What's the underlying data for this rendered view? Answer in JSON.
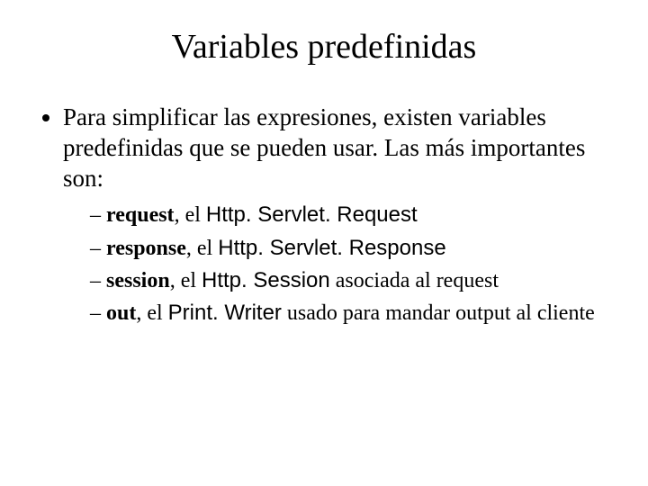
{
  "title": "Variables predefinidas",
  "intro": "Para simplificar las expresiones, existen variables predefinidas que se pueden usar. Las más importantes son:",
  "items": {
    "i0": {
      "name": " request",
      "mid": ", el ",
      "code": "Http. Servlet. Request",
      "tail": ""
    },
    "i1": {
      "name": "response",
      "mid": ", el ",
      "code": "Http. Servlet. Response",
      "tail": ""
    },
    "i2": {
      "name": "session",
      "mid": ", el ",
      "code": "Http. Session",
      "tail": " asociada al request"
    },
    "i3": {
      "name": "out",
      "mid": ", el ",
      "code": "Print. Writer",
      "tail": " usado para mandar output al cliente"
    }
  }
}
